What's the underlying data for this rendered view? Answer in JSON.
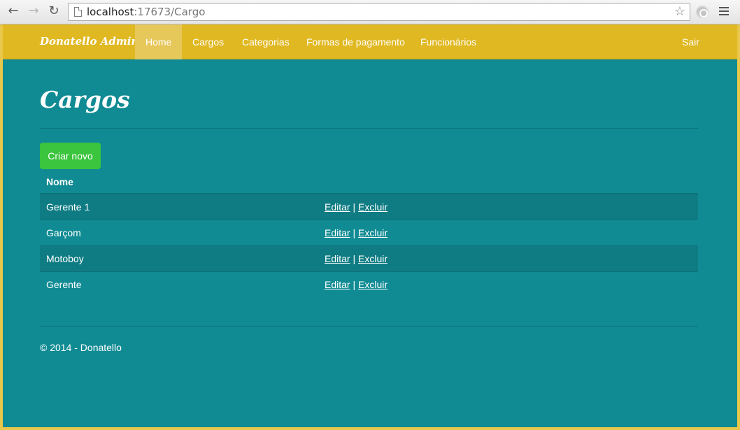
{
  "browser": {
    "url_host": "localhost",
    "url_path": ":17673/Cargo",
    "back_icon": "back-arrow-icon",
    "forward_icon": "forward-arrow-icon",
    "reload_icon": "reload-icon",
    "bookmark_icon": "star-icon",
    "menu_icon": "hamburger-menu-icon"
  },
  "navbar": {
    "brand": "Donatello Admin",
    "items": [
      {
        "label": "Home",
        "active": true
      },
      {
        "label": "Cargos"
      },
      {
        "label": "Categorias"
      },
      {
        "label": "Formas de pagamento"
      },
      {
        "label": "Funcionários"
      }
    ],
    "logout": "Sair",
    "color": "#e0b822"
  },
  "main": {
    "title": "Cargos",
    "create_button": "Criar novo",
    "table": {
      "header_name": "Nome",
      "rows": [
        {
          "name": "Gerente 1",
          "edit": "Editar",
          "delete": "Excluir"
        },
        {
          "name": "Garçom",
          "edit": "Editar",
          "delete": "Excluir"
        },
        {
          "name": "Motoboy",
          "edit": "Editar",
          "delete": "Excluir"
        },
        {
          "name": "Gerente",
          "edit": "Editar",
          "delete": "Excluir"
        }
      ],
      "separator": "|"
    },
    "background": "#108b93",
    "button_color": "#3bc43d"
  },
  "footer": {
    "text": "© 2014 - Donatello"
  }
}
